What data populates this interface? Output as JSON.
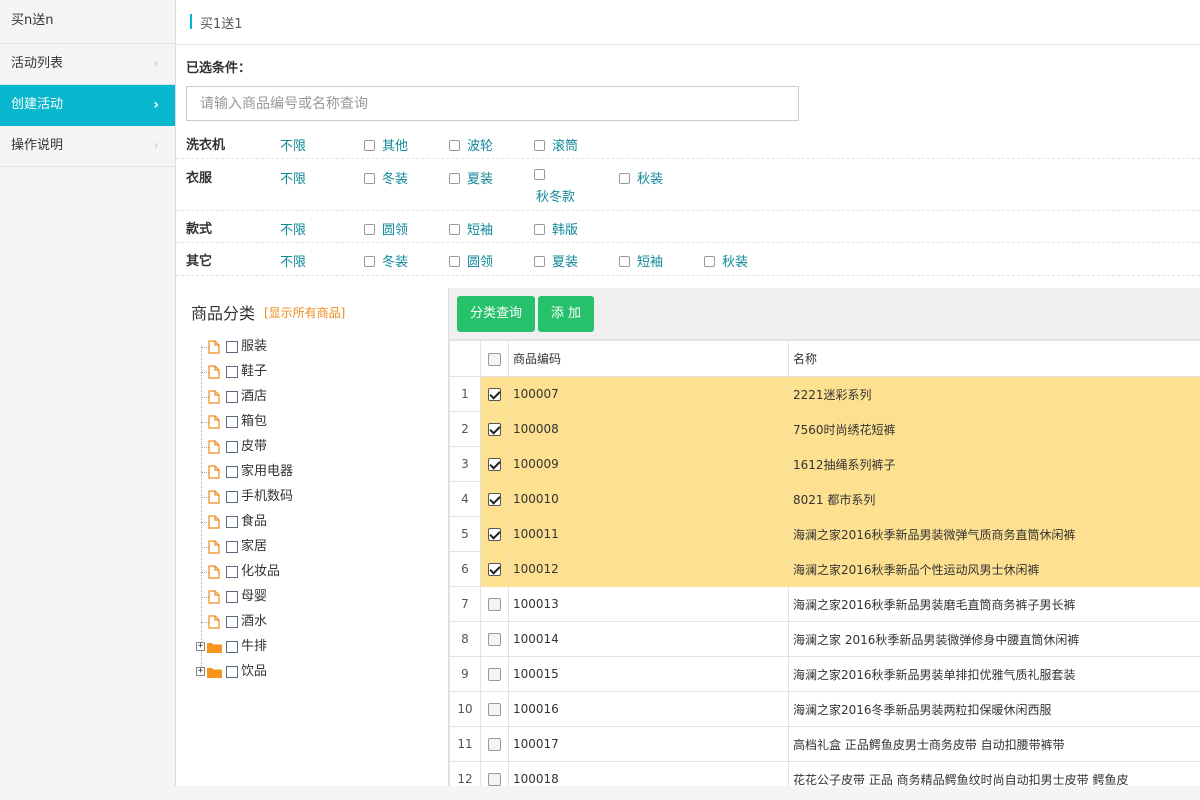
{
  "sidebar": {
    "logo": "买n送n",
    "items": [
      {
        "label": "活动列表",
        "chevron": "›"
      },
      {
        "label": "创建活动",
        "chevron": "›"
      },
      {
        "label": "操作说明",
        "chevron": "›"
      }
    ]
  },
  "header": {
    "title": "买1送1"
  },
  "filters": {
    "selected_label": "已选条件：",
    "search_placeholder": "请输入商品编号或名称查询",
    "rows": [
      {
        "name": "洗衣机",
        "unlimited": "不限",
        "options": [
          "其他",
          "波轮",
          "滚筒"
        ]
      },
      {
        "name": "衣服",
        "unlimited": "不限",
        "options": [
          "冬装",
          "夏装",
          "秋冬款",
          "秋装"
        ]
      },
      {
        "name": "款式",
        "unlimited": "不限",
        "options": [
          "圆领",
          "短袖",
          "韩版"
        ]
      },
      {
        "name": "其它",
        "unlimited": "不限",
        "options": [
          "冬装",
          "圆领",
          "夏装",
          "短袖",
          "秋装"
        ]
      }
    ]
  },
  "category": {
    "title": "商品分类",
    "show_all": "[显示所有商品]",
    "nodes": [
      {
        "label": "服装",
        "type": "file"
      },
      {
        "label": "鞋子",
        "type": "file"
      },
      {
        "label": "酒店",
        "type": "file"
      },
      {
        "label": "箱包",
        "type": "file"
      },
      {
        "label": "皮带",
        "type": "file"
      },
      {
        "label": "家用电器",
        "type": "file"
      },
      {
        "label": "手机数码",
        "type": "file"
      },
      {
        "label": "食品",
        "type": "file"
      },
      {
        "label": "家居",
        "type": "file"
      },
      {
        "label": "化妆品",
        "type": "file"
      },
      {
        "label": "母婴",
        "type": "file"
      },
      {
        "label": "酒水",
        "type": "file"
      },
      {
        "label": "牛排",
        "type": "folder",
        "expander": "+"
      },
      {
        "label": "饮品",
        "type": "folder",
        "expander": "+"
      }
    ]
  },
  "grid": {
    "buttons": {
      "query": "分类查询",
      "add": "添 加"
    },
    "columns": {
      "code": "商品编码",
      "name": "名称"
    },
    "rows": [
      {
        "n": "1",
        "code": "100007",
        "name": "2221迷彩系列",
        "checked": true
      },
      {
        "n": "2",
        "code": "100008",
        "name": "7560时尚绣花短裤",
        "checked": true
      },
      {
        "n": "3",
        "code": "100009",
        "name": "1612抽绳系列裤子",
        "checked": true
      },
      {
        "n": "4",
        "code": "100010",
        "name": "8021 都市系列",
        "checked": true
      },
      {
        "n": "5",
        "code": "100011",
        "name": "海澜之家2016秋季新品男装微弹气质商务直筒休闲裤",
        "checked": true
      },
      {
        "n": "6",
        "code": "100012",
        "name": "海澜之家2016秋季新品个性运动风男士休闲裤",
        "checked": true
      },
      {
        "n": "7",
        "code": "100013",
        "name": "海澜之家2016秋季新品男装磨毛直筒商务裤子男长裤",
        "checked": false
      },
      {
        "n": "8",
        "code": "100014",
        "name": "海澜之家 2016秋季新品男装微弹修身中腰直筒休闲裤",
        "checked": false
      },
      {
        "n": "9",
        "code": "100015",
        "name": "海澜之家2016秋季新品男装单排扣优雅气质礼服套装",
        "checked": false
      },
      {
        "n": "10",
        "code": "100016",
        "name": "海澜之家2016冬季新品男装两粒扣保暖休闲西服",
        "checked": false
      },
      {
        "n": "11",
        "code": "100017",
        "name": "高档礼盒 正品鳄鱼皮男士商务皮带 自动扣腰带裤带",
        "checked": false
      },
      {
        "n": "12",
        "code": "100018",
        "name": "花花公子皮带 正品 商务精品鳄鱼纹时尚自动扣男士皮带 鳄鱼皮",
        "checked": false
      }
    ]
  },
  "colors": {
    "accent": "#08b7cd",
    "button": "#27c06b",
    "selected_row": "#fde190",
    "link": "#11899a",
    "orange": "#f08a1a"
  }
}
